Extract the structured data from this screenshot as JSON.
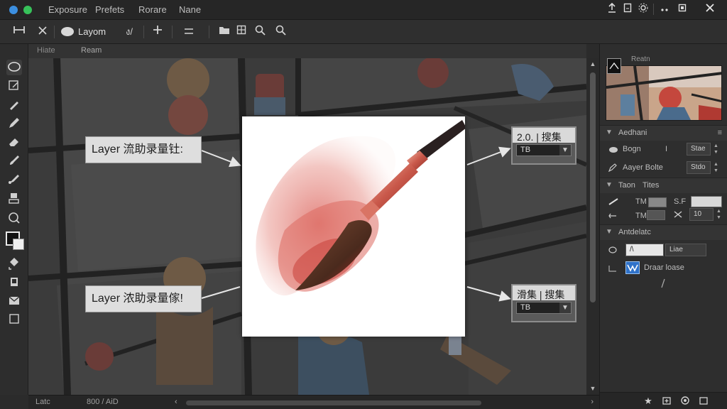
{
  "menubar": {
    "items": [
      "Exposure",
      "Prefets",
      "Rorare",
      "Nane"
    ]
  },
  "window_controls": {
    "icons": [
      "export-icon",
      "document-icon",
      "settings-icon",
      "more-icon",
      "restore-icon",
      "close-icon"
    ]
  },
  "toolbar": {
    "layer_label": "Layom",
    "dropdown_label": "ง/",
    "buttons": [
      "crop-icon",
      "close-icon",
      "add-icon",
      "menu-icon",
      "folder-icon",
      "panel-icon",
      "zoom-icon",
      "search-icon"
    ]
  },
  "tabs": [
    {
      "label": "Hiate"
    },
    {
      "label": "Ream"
    }
  ],
  "tools": [
    "lasso-tool-icon",
    "crop-tool-icon",
    "pen-tool-icon",
    "pencil-tool-icon",
    "eraser-tool-icon",
    "brush-tool-icon",
    "smudge-tool-icon",
    "stamp-tool-icon",
    "dodge-tool-icon",
    "bucket-tool-icon",
    "layer-tool-icon",
    "mask-tool-icon",
    "frame-tool-icon"
  ],
  "colors": {
    "foreground": "#111111",
    "background": "#f0f0f0",
    "accent": "#3c8fe0"
  },
  "callouts": {
    "top_left": "Layer 流助录量钍:",
    "bottom_left": "Layer 浓助录量傢!"
  },
  "fields": {
    "top_right": {
      "label": "2.0. | 搜集",
      "value": "TB"
    },
    "bottom_right": {
      "label": "滑集 | 搜集",
      "value": "TB"
    }
  },
  "status": {
    "left": "Latc",
    "zoom": "800 / AiD"
  },
  "panel": {
    "navigator_label": "Reatn",
    "adjust": {
      "title": "Aedhani",
      "rows": [
        {
          "label": "Bogn",
          "sep": "I",
          "value": "Stae"
        },
        {
          "label": "Aayer Bolte",
          "value": "Stdo"
        }
      ]
    },
    "tools": {
      "title": "Taon",
      "title2": "Tites",
      "row1": {
        "tag": "TM",
        "tag2": "S.F"
      },
      "row2": {
        "tag": "TM",
        "value": "10"
      }
    },
    "artistic": {
      "title": "Antdelatc",
      "row1": {
        "value1": "/\\",
        "value2": "Liae"
      },
      "row2": {
        "label": "Draar loase"
      }
    }
  }
}
